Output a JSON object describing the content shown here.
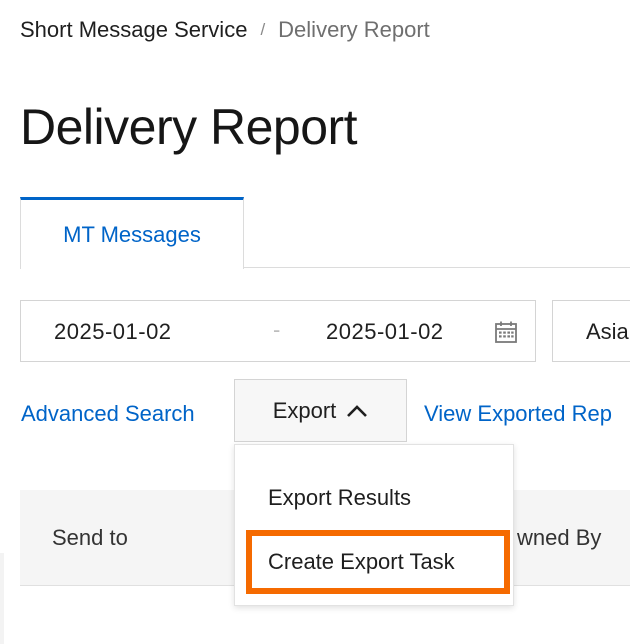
{
  "breadcrumb": {
    "parent": "Short Message Service",
    "separator": "/",
    "current": "Delivery Report"
  },
  "page": {
    "title": "Delivery Report"
  },
  "tabs": [
    {
      "label": "MT Messages",
      "active": true
    }
  ],
  "filters": {
    "date_start": "2025-01-02",
    "date_separator": "-",
    "date_end": "2025-01-02",
    "calendar_icon": "calendar-icon",
    "timezone_visible": "Asia"
  },
  "actions": {
    "advanced_search": "Advanced Search",
    "export": "Export",
    "export_icon": "chevron-up-icon",
    "view_exported": "View Exported Rep"
  },
  "export_menu": {
    "items": [
      "Export Results",
      "Create Export Task"
    ],
    "highlighted_item": "Create Export Task"
  },
  "table": {
    "columns": [
      "Send to",
      "wned By"
    ]
  },
  "colors": {
    "link": "#0064c8",
    "highlight": "#f56a00",
    "header_bg": "#f5f5f5"
  }
}
